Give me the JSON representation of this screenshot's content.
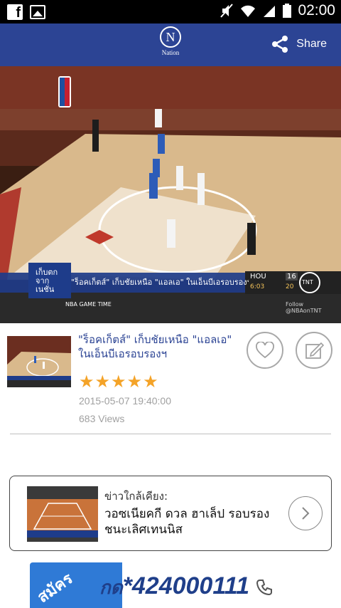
{
  "status_bar": {
    "time": "02:00"
  },
  "header": {
    "logo_letter": "N",
    "logo_text": "Nation",
    "share_label": "Share"
  },
  "video": {
    "caption_title": "\"ร็อคเก็ตส์\" เก็บชัยเหนือ \"แอลเอ\" ในเอ็นบีเอรอบรองฯ",
    "brand_badge": "เก็บตก จาก เนชั่น",
    "ticker": "NBA GAME TIME",
    "score_team1": "HOU",
    "score_value1": "16",
    "score_clock": "6:03",
    "score_value2": "20",
    "channel": "TNT",
    "footer": "Follow @NBAonTNT"
  },
  "article": {
    "title": "\"ร็อคเก็ตส์\" เก็บชัยเหนือ \"แอลเอ\" ในเอ็นบีเอรอบรองฯ",
    "rating": 5,
    "stars": [
      "★",
      "★",
      "★",
      "★",
      "★"
    ],
    "date": "2015-05-07 19:40:00",
    "views": "683 Views"
  },
  "nearby": {
    "label": "ข่าวใกล้เคียง:",
    "title": "วอซเนียคกี ดวล ฮาเล็ป รอบรองชนะเลิศเทนนิส"
  },
  "banner": {
    "tab_text": "สมัคร",
    "prefix": "กด",
    "star": "*",
    "number": "424000111"
  },
  "colors": {
    "header": "#2c4494",
    "accent_star": "#f4a328",
    "link": "#2c4494"
  }
}
